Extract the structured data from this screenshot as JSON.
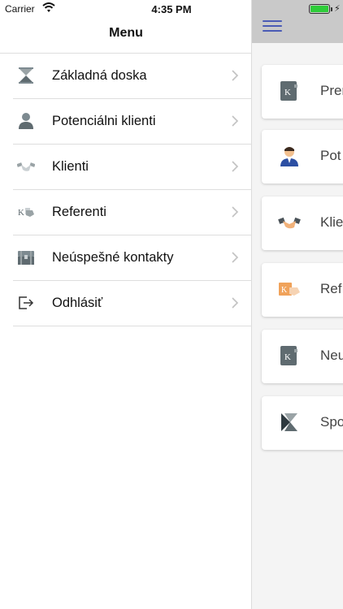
{
  "status_bar": {
    "carrier": "Carrier",
    "time": "4:35 PM"
  },
  "menu": {
    "title": "Menu",
    "items": [
      {
        "label": "Základná doska",
        "icon": "hourglass-icon"
      },
      {
        "label": "Potenciálni klienti",
        "icon": "person-icon"
      },
      {
        "label": "Klienti",
        "icon": "handshake-icon"
      },
      {
        "label": "Referenti",
        "icon": "referral-card-icon"
      },
      {
        "label": "Neúspešné kontakty",
        "icon": "treasure-chest-icon"
      },
      {
        "label": "Odhlásiť",
        "icon": "logout-icon"
      }
    ]
  },
  "background_cards": [
    {
      "label": "Prem",
      "icon": "document-k-icon"
    },
    {
      "label": "Pot",
      "icon": "agent-icon"
    },
    {
      "label": "Klie",
      "icon": "handshake-icon"
    },
    {
      "label": "Ref",
      "icon": "referral-card-icon"
    },
    {
      "label": "Neu",
      "icon": "document-k-icon"
    },
    {
      "label": "Spo",
      "icon": "k-logo-icon"
    }
  ],
  "colors": {
    "accent": "#4a5bb5",
    "battery": "#2ecc3a",
    "header_bg": "#c9c9c9"
  }
}
